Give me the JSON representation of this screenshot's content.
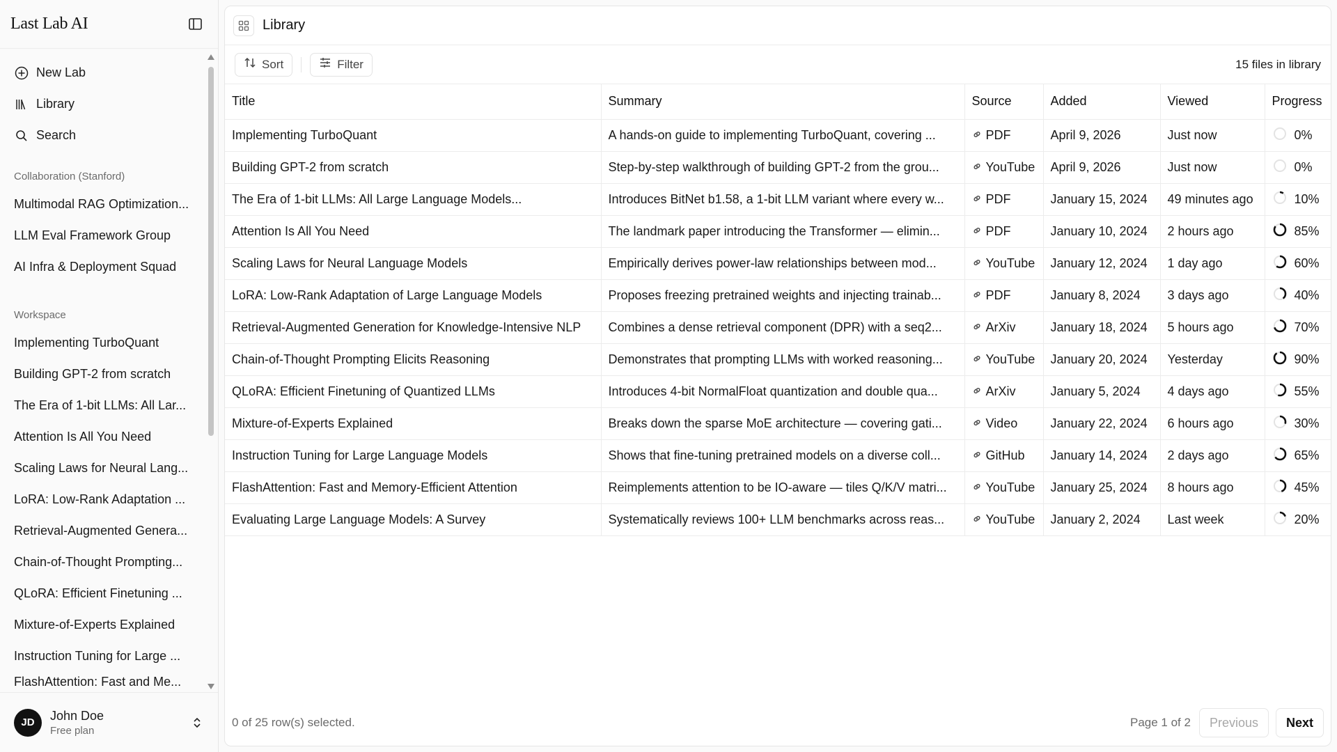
{
  "app": {
    "brand": "Last Lab AI"
  },
  "sidebar": {
    "nav": [
      {
        "label": "New Lab",
        "icon": "plus-circle-icon"
      },
      {
        "label": "Library",
        "icon": "library-icon"
      },
      {
        "label": "Search",
        "icon": "search-icon"
      }
    ],
    "collab_heading": "Collaboration (Stanford)",
    "collab_items": [
      "Multimodal RAG Optimization...",
      "LLM Eval Framework Group",
      "AI Infra & Deployment Squad"
    ],
    "workspace_heading": "Workspace",
    "workspace_items": [
      "Implementing TurboQuant",
      "Building GPT-2 from scratch",
      "The Era of 1-bit LLMs: All Lar...",
      "Attention Is All You Need",
      "Scaling Laws for Neural Lang...",
      "LoRA: Low-Rank Adaptation ...",
      "Retrieval-Augmented Genera...",
      "Chain-of-Thought Prompting...",
      "QLoRA: Efficient Finetuning ...",
      "Mixture-of-Experts Explained",
      "Instruction Tuning for Large ...",
      "FlashAttention: Fast and Me..."
    ],
    "user": {
      "initials": "JD",
      "name": "John Doe",
      "plan": "Free plan"
    }
  },
  "main": {
    "title": "Library",
    "toolbar": {
      "sort_label": "Sort",
      "filter_label": "Filter",
      "file_count": "15 files in library"
    },
    "columns": [
      "Title",
      "Summary",
      "Source",
      "Added",
      "Viewed",
      "Progress"
    ],
    "rows": [
      {
        "title": "Implementing TurboQuant",
        "summary": "A hands-on guide to implementing TurboQuant, covering ...",
        "source": "PDF",
        "added": "April 9, 2026",
        "viewed": "Just now",
        "progress": 0,
        "progress_label": "0%"
      },
      {
        "title": "Building GPT-2 from scratch",
        "summary": "Step-by-step walkthrough of building GPT-2 from the grou...",
        "source": "YouTube",
        "added": "April 9, 2026",
        "viewed": "Just now",
        "progress": 0,
        "progress_label": "0%"
      },
      {
        "title": "The Era of 1-bit LLMs: All Large Language Models...",
        "summary": "Introduces BitNet b1.58, a 1-bit LLM variant where every w...",
        "source": "PDF",
        "added": "January 15, 2024",
        "viewed": "49 minutes ago",
        "progress": 10,
        "progress_label": "10%"
      },
      {
        "title": "Attention Is All You Need",
        "summary": "The landmark paper introducing the Transformer — elimin...",
        "source": "PDF",
        "added": "January 10, 2024",
        "viewed": "2 hours ago",
        "progress": 85,
        "progress_label": "85%"
      },
      {
        "title": "Scaling Laws for Neural Language Models",
        "summary": "Empirically derives power-law relationships between mod...",
        "source": "YouTube",
        "added": "January 12, 2024",
        "viewed": "1 day ago",
        "progress": 60,
        "progress_label": "60%"
      },
      {
        "title": "LoRA: Low-Rank Adaptation of Large Language Models",
        "summary": "Proposes freezing pretrained weights and injecting trainab...",
        "source": "PDF",
        "added": "January 8, 2024",
        "viewed": "3 days ago",
        "progress": 40,
        "progress_label": "40%"
      },
      {
        "title": "Retrieval-Augmented Generation for Knowledge-Intensive NLP",
        "summary": "Combines a dense retrieval component (DPR) with a seq2...",
        "source": "ArXiv",
        "added": "January 18, 2024",
        "viewed": "5 hours ago",
        "progress": 70,
        "progress_label": "70%"
      },
      {
        "title": "Chain-of-Thought Prompting Elicits Reasoning",
        "summary": "Demonstrates that prompting LLMs with worked reasoning...",
        "source": "YouTube",
        "added": "January 20, 2024",
        "viewed": "Yesterday",
        "progress": 90,
        "progress_label": "90%"
      },
      {
        "title": "QLoRA: Efficient Finetuning of Quantized LLMs",
        "summary": "Introduces 4-bit NormalFloat quantization and double qua...",
        "source": "ArXiv",
        "added": "January 5, 2024",
        "viewed": "4 days ago",
        "progress": 55,
        "progress_label": "55%"
      },
      {
        "title": "Mixture-of-Experts Explained",
        "summary": "Breaks down the sparse MoE architecture — covering gati...",
        "source": "Video",
        "added": "January 22, 2024",
        "viewed": "6 hours ago",
        "progress": 30,
        "progress_label": "30%"
      },
      {
        "title": "Instruction Tuning for Large Language Models",
        "summary": "Shows that fine-tuning pretrained models on a diverse coll...",
        "source": "GitHub",
        "added": "January 14, 2024",
        "viewed": "2 days ago",
        "progress": 65,
        "progress_label": "65%"
      },
      {
        "title": "FlashAttention: Fast and Memory-Efficient Attention",
        "summary": "Reimplements attention to be IO-aware — tiles Q/K/V matri...",
        "source": "YouTube",
        "added": "January 25, 2024",
        "viewed": "8 hours ago",
        "progress": 45,
        "progress_label": "45%"
      },
      {
        "title": "Evaluating Large Language Models: A Survey",
        "summary": "Systematically reviews 100+ LLM benchmarks across reas...",
        "source": "YouTube",
        "added": "January 2, 2024",
        "viewed": "Last week",
        "progress": 20,
        "progress_label": "20%"
      }
    ],
    "footer": {
      "selection": "0 of 25 row(s) selected.",
      "page_info": "Page 1 of 2",
      "prev_label": "Previous",
      "next_label": "Next"
    }
  },
  "colors": {
    "progress_track": "#e3e3e3",
    "progress_fill": "#111111",
    "border": "#ececec",
    "muted_text": "#6b6b6b"
  }
}
